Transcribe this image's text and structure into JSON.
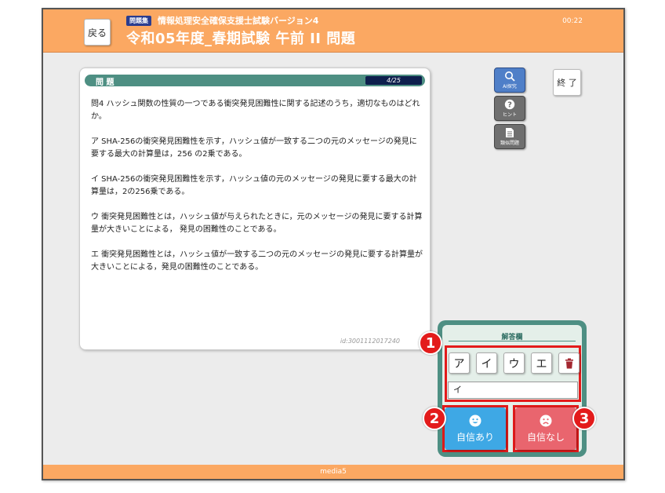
{
  "header": {
    "back_label": "戻る",
    "tag": "問題集",
    "subtitle": "情報処理安全確保支援士試験バージョン4",
    "title": "令和05年度_春期試験 午前 II 問題",
    "timer": "00:22"
  },
  "question": {
    "header_label": "問 題",
    "count": "4/25",
    "stem": "問4 ハッシュ関数の性質の一つである衝突発見困難性に関する記述のうち，適切なものはどれか。",
    "options": [
      "ア SHA-256の衝突発見困難性を示す，ハッシュ値が一致する二つの元のメッセージの発見に要する最大の計算量は，256 の2乗である。",
      "イ SHA-256の衝突発見困難性を示す，ハッシュ値の元のメッセージの発見に要する最大の計算量は，2の256乗である。",
      "ウ 衝突発見困難性とは，ハッシュ値が与えられたときに，元のメッセージの発見に要する計算量が大きいことによる， 発見の困難性のことである。",
      "エ 衝突発見困難性とは，ハッシュ値が一致する二つの元のメッセージの発見に要する計算量が大きいことによる，発見の困難性のことである。"
    ],
    "id": "id:3001112017240"
  },
  "side": {
    "ai_label": "AI探究",
    "hint_label": "ヒント",
    "similar_label": "類似問題",
    "end_label": "終 了"
  },
  "answer": {
    "title": "解答欄",
    "choices": [
      "ア",
      "イ",
      "ウ",
      "エ"
    ],
    "value": "イ",
    "confident_label": "自信あり",
    "not_confident_label": "自信なし"
  },
  "badges": [
    "1",
    "2",
    "3"
  ],
  "footer": "media5",
  "colors": {
    "header": "#fba862",
    "panel_green": "#4e8f83",
    "highlight": "#e31b1b",
    "confident": "#3ea8e5",
    "not_confident": "#e9656e"
  },
  "icons": {
    "ai": "magnifier-icon",
    "hint": "question-icon",
    "similar": "document-icon",
    "trash": "trash-icon",
    "confident": "smile-icon",
    "not_confident": "sad-icon"
  }
}
